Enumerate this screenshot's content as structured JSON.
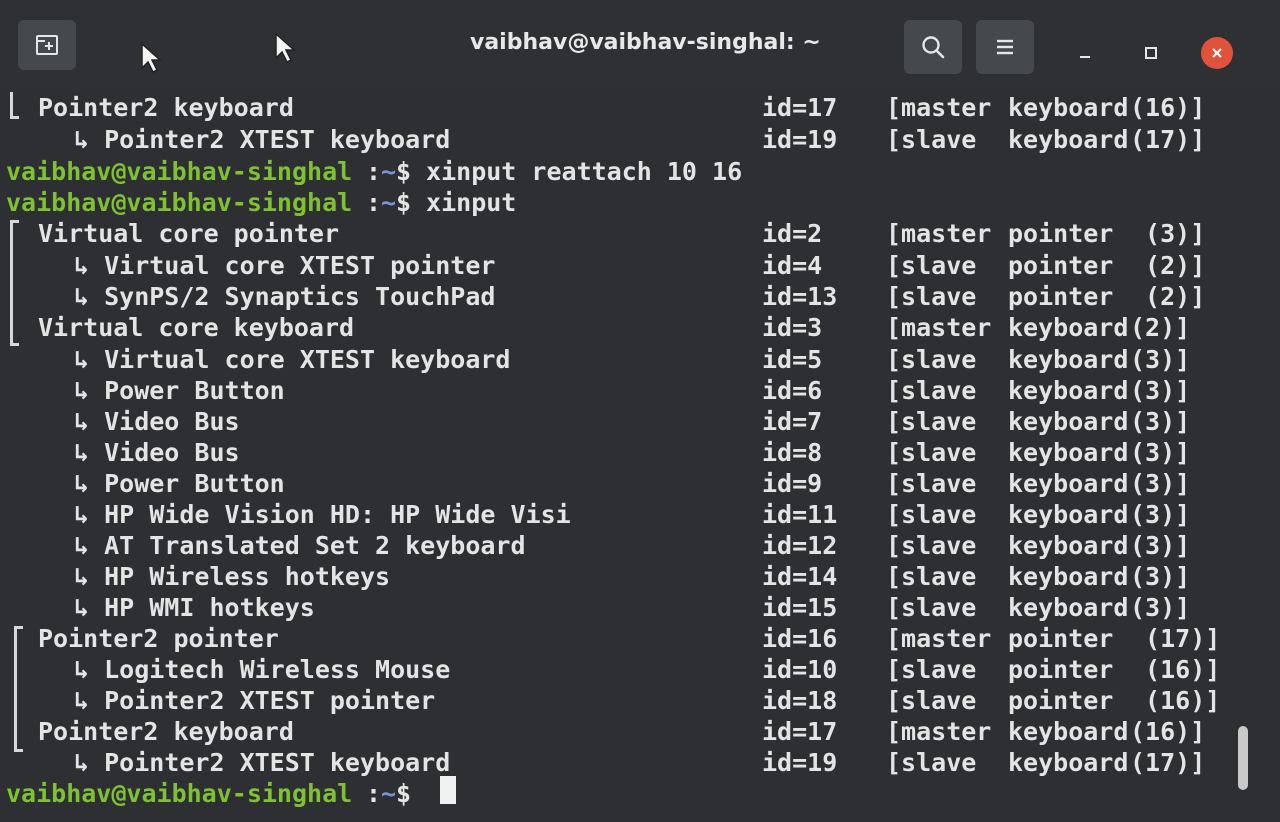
{
  "window": {
    "title": "vaibhav@vaibhav-singhal: ~"
  },
  "titlebar": {
    "new_tab_icon": "new-tab-icon",
    "search_icon": "search-icon",
    "menu_icon": "hamburger-menu-icon",
    "minimize_glyph": "–",
    "maximize_glyph": "□",
    "close_glyph": "×"
  },
  "colors": {
    "prompt_user": "#7ec232",
    "prompt_path": "#7895d8",
    "text": "#e4e4e4",
    "close": "#e0533a"
  },
  "prompt": {
    "user": "vaibhav@vaibhav-singhal",
    "sep": ":",
    "path": "~",
    "dollar": "$"
  },
  "lines": [
    {
      "kind": "device",
      "name": "Pointer2 keyboard",
      "id": "id=17",
      "role": "[master",
      "type": "keyboard",
      "parent": "(16)]"
    },
    {
      "kind": "device",
      "name": "↳ Pointer2 XTEST keyboard",
      "id": "id=19",
      "role": "[slave",
      "type": "keyboard",
      "parent": "(17)]"
    },
    {
      "kind": "prompt",
      "cmd": " xinput reattach 10 16"
    },
    {
      "kind": "prompt",
      "cmd": " xinput"
    },
    {
      "kind": "device",
      "name": "Virtual core pointer",
      "id": "id=2",
      "role": "[master",
      "type": "pointer",
      "parent": " (3)]"
    },
    {
      "kind": "device",
      "name": "↳ Virtual core XTEST pointer",
      "id": "id=4",
      "role": "[slave",
      "type": "pointer",
      "parent": " (2)]"
    },
    {
      "kind": "device",
      "name": "↳ SynPS/2 Synaptics TouchPad",
      "id": "id=13",
      "role": "[slave",
      "type": "pointer",
      "parent": " (2)]"
    },
    {
      "kind": "device",
      "name": "Virtual core keyboard",
      "id": "id=3",
      "role": "[master",
      "type": "keyboard",
      "parent": "(2)]"
    },
    {
      "kind": "device",
      "name": "↳ Virtual core XTEST keyboard",
      "id": "id=5",
      "role": "[slave",
      "type": "keyboard",
      "parent": "(3)]"
    },
    {
      "kind": "device",
      "name": "↳ Power Button",
      "id": "id=6",
      "role": "[slave",
      "type": "keyboard",
      "parent": "(3)]"
    },
    {
      "kind": "device",
      "name": "↳ Video Bus",
      "id": "id=7",
      "role": "[slave",
      "type": "keyboard",
      "parent": "(3)]"
    },
    {
      "kind": "device",
      "name": "↳ Video Bus",
      "id": "id=8",
      "role": "[slave",
      "type": "keyboard",
      "parent": "(3)]"
    },
    {
      "kind": "device",
      "name": "↳ Power Button",
      "id": "id=9",
      "role": "[slave",
      "type": "keyboard",
      "parent": "(3)]"
    },
    {
      "kind": "device",
      "name": "↳ HP Wide Vision HD: HP Wide Visi",
      "id": "id=11",
      "role": "[slave",
      "type": "keyboard",
      "parent": "(3)]"
    },
    {
      "kind": "device",
      "name": "↳ AT Translated Set 2 keyboard",
      "id": "id=12",
      "role": "[slave",
      "type": "keyboard",
      "parent": "(3)]"
    },
    {
      "kind": "device",
      "name": "↳ HP Wireless hotkeys",
      "id": "id=14",
      "role": "[slave",
      "type": "keyboard",
      "parent": "(3)]"
    },
    {
      "kind": "device",
      "name": "↳ HP WMI hotkeys",
      "id": "id=15",
      "role": "[slave",
      "type": "keyboard",
      "parent": "(3)]"
    },
    {
      "kind": "device",
      "name": "Pointer2 pointer",
      "id": "id=16",
      "role": "[master",
      "type": "pointer",
      "parent": " (17)]"
    },
    {
      "kind": "device",
      "name": "↳ Logitech Wireless Mouse",
      "id": "id=10",
      "role": "[slave",
      "type": "pointer",
      "parent": " (16)]"
    },
    {
      "kind": "device",
      "name": "↳ Pointer2 XTEST pointer",
      "id": "id=18",
      "role": "[slave",
      "type": "pointer",
      "parent": " (16)]"
    },
    {
      "kind": "device",
      "name": "Pointer2 keyboard",
      "id": "id=17",
      "role": "[master",
      "type": "keyboard",
      "parent": "(16)]"
    },
    {
      "kind": "device",
      "name": "↳ Pointer2 XTEST keyboard",
      "id": "id=19",
      "role": "[slave",
      "type": "keyboard",
      "parent": "(17)]"
    },
    {
      "kind": "prompt",
      "cmd": " "
    }
  ]
}
